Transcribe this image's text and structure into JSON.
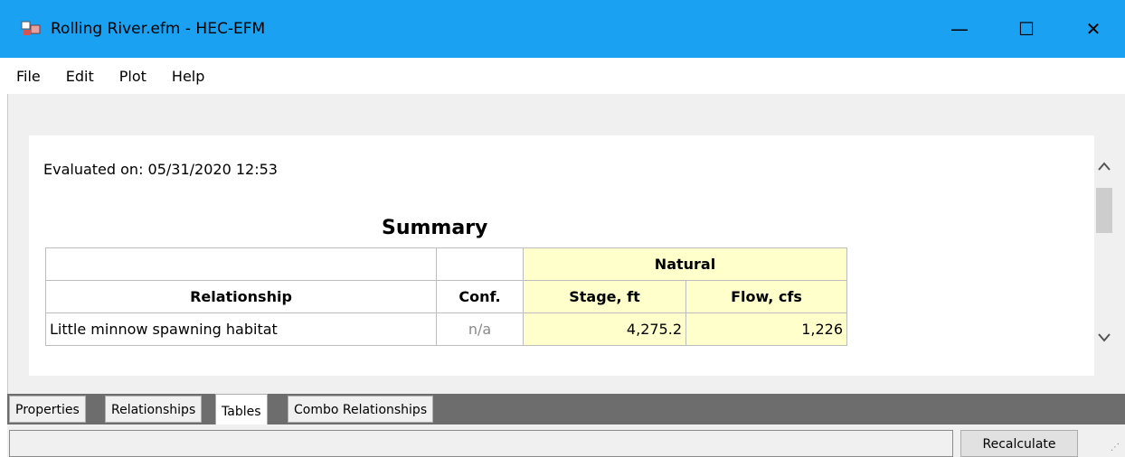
{
  "window": {
    "title": "Rolling River.efm - HEC-EFM",
    "minimize_glyph": "—",
    "maximize_glyph": "☐",
    "close_glyph": "✕",
    "app_icon": "hec-efm-app-icon"
  },
  "menubar": {
    "items": [
      {
        "label": "File"
      },
      {
        "label": "Edit"
      },
      {
        "label": "Plot"
      },
      {
        "label": "Help"
      }
    ]
  },
  "report": {
    "evaluated": "Evaluated on: 05/31/2020 12:53",
    "title": "Summary",
    "group_header": "Natural",
    "columns": [
      "Relationship",
      "Conf.",
      "Stage, ft",
      "Flow, cfs"
    ],
    "rows": [
      {
        "relationship": "Little minnow spawning habitat",
        "conf": "n/a",
        "stage": "4,275.2",
        "flow": "1,226"
      }
    ],
    "highlight_color": "#ffffcc"
  },
  "scrollbar": {
    "up_icon": "chevron-up-icon",
    "down_icon": "chevron-down-icon"
  },
  "tabs": [
    {
      "label": "Properties",
      "active": false
    },
    {
      "label": "Relationships",
      "active": false
    },
    {
      "label": "Tables",
      "active": true
    },
    {
      "label": "Combo Relationships",
      "active": false
    }
  ],
  "bottom": {
    "status_text": "",
    "recalculate_label": "Recalculate"
  },
  "colors": {
    "titlebar": "#1ba1f2",
    "tabstrip": "#6d6d6d"
  }
}
